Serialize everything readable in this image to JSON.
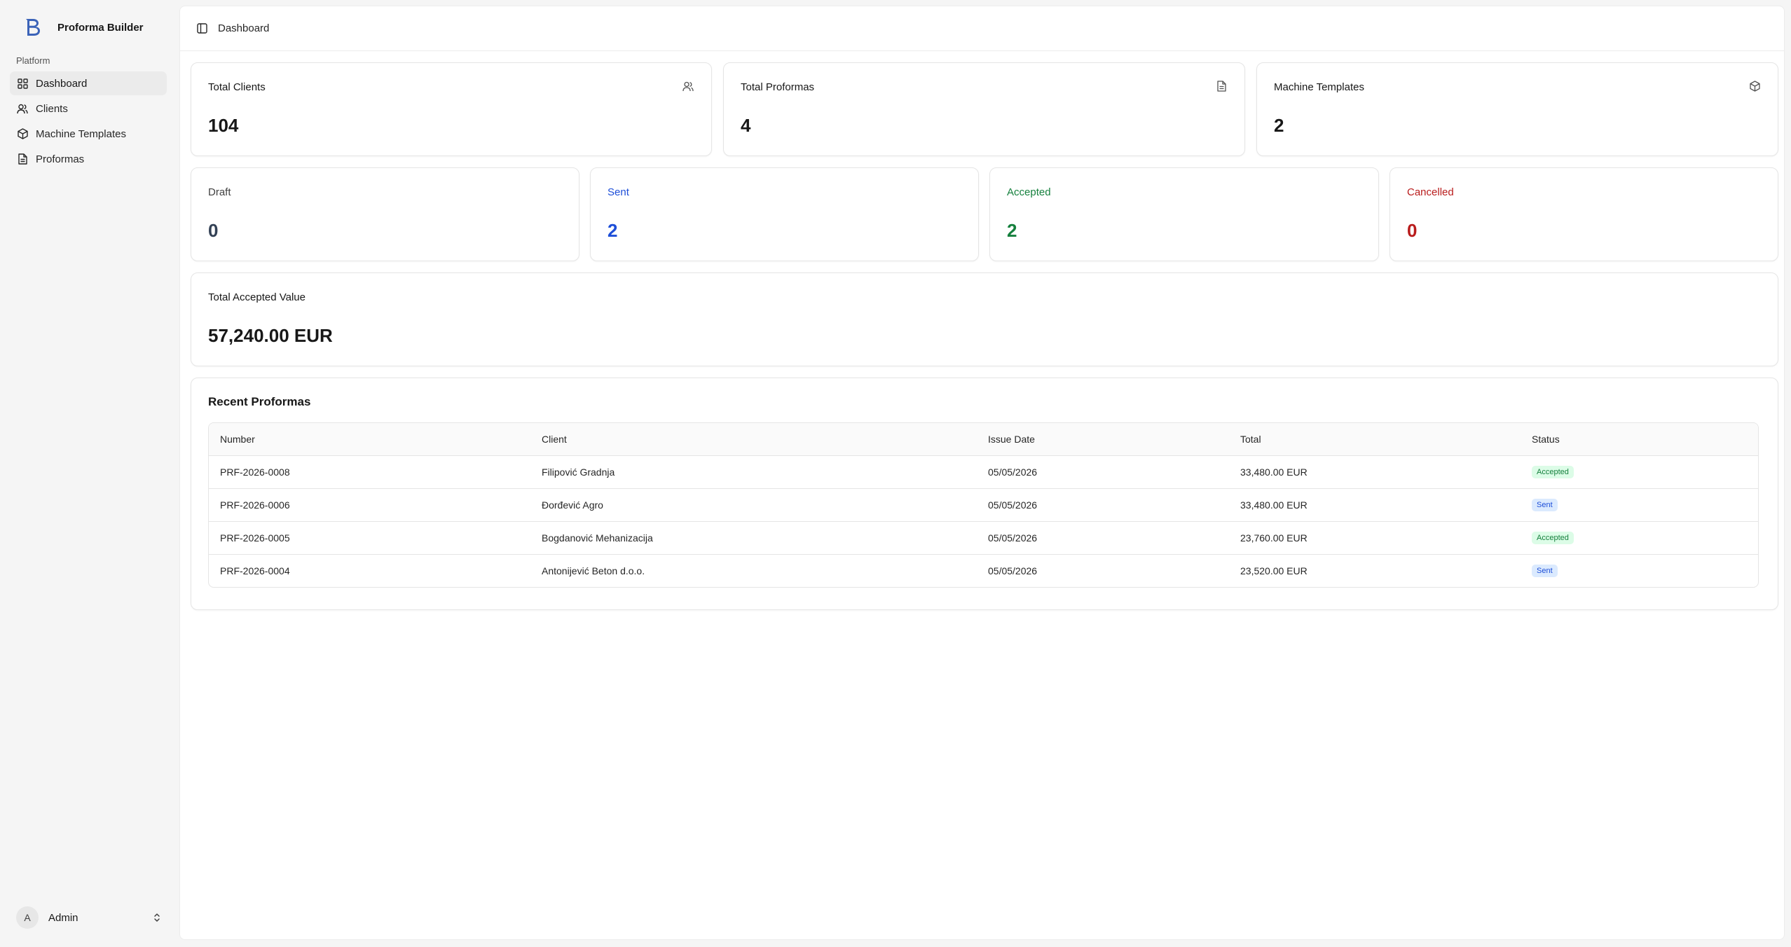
{
  "app": {
    "name": "Proforma Builder"
  },
  "sidebar": {
    "group_label": "Platform",
    "items": [
      {
        "label": "Dashboard",
        "icon": "grid-icon",
        "active": true
      },
      {
        "label": "Clients",
        "icon": "users-icon"
      },
      {
        "label": "Machine Templates",
        "icon": "box-icon"
      },
      {
        "label": "Proformas",
        "icon": "file-icon"
      }
    ],
    "user": {
      "initial": "A",
      "name": "Admin"
    }
  },
  "header": {
    "breadcrumb": "Dashboard"
  },
  "stats": {
    "total_clients": {
      "label": "Total Clients",
      "value": "104"
    },
    "total_proformas": {
      "label": "Total Proformas",
      "value": "4"
    },
    "machine_templates": {
      "label": "Machine Templates",
      "value": "2"
    }
  },
  "statuses": {
    "draft": {
      "label": "Draft",
      "value": "0",
      "color": "#334155"
    },
    "sent": {
      "label": "Sent",
      "value": "2",
      "color": "#1d4ed8"
    },
    "accepted": {
      "label": "Accepted",
      "value": "2",
      "color": "#15803d"
    },
    "cancelled": {
      "label": "Cancelled",
      "value": "0",
      "color": "#b91c1c"
    }
  },
  "accepted_value": {
    "label": "Total Accepted Value",
    "value": "57,240.00 EUR"
  },
  "recent": {
    "title": "Recent Proformas",
    "columns": [
      "Number",
      "Client",
      "Issue Date",
      "Total",
      "Status"
    ],
    "rows": [
      {
        "number": "PRF-2026-0008",
        "client": "Filipović Gradnja",
        "date": "05/05/2026",
        "total": "33,480.00 EUR",
        "status": "Accepted"
      },
      {
        "number": "PRF-2026-0006",
        "client": "Đorđević Agro",
        "date": "05/05/2026",
        "total": "33,480.00 EUR",
        "status": "Sent"
      },
      {
        "number": "PRF-2026-0005",
        "client": "Bogdanović Mehanizacija",
        "date": "05/05/2026",
        "total": "23,760.00 EUR",
        "status": "Accepted"
      },
      {
        "number": "PRF-2026-0004",
        "client": "Antonijević Beton d.o.o.",
        "date": "05/05/2026",
        "total": "23,520.00 EUR",
        "status": "Sent"
      }
    ]
  }
}
